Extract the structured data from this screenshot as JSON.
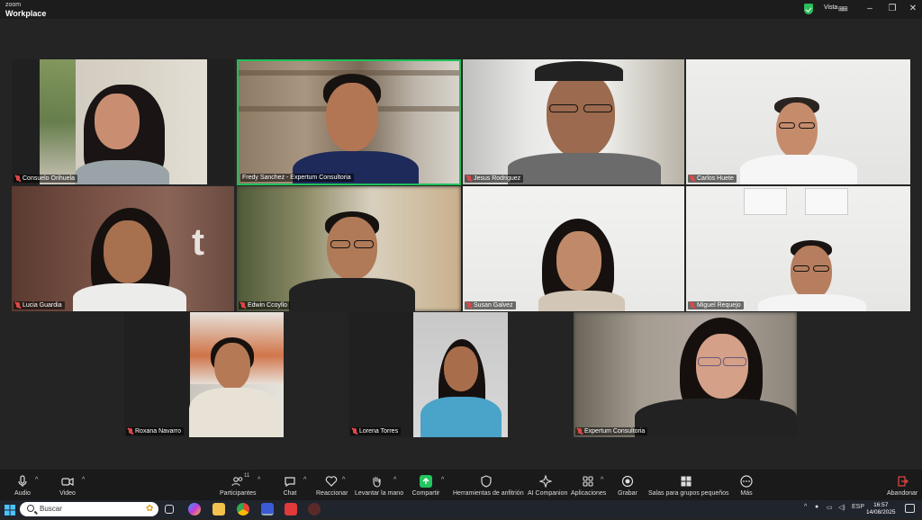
{
  "app": {
    "logo_line1": "zoom",
    "logo_line2": "Workplace",
    "view_label": "Vista",
    "view_icon": "⊞⊞"
  },
  "window_controls": {
    "minimize": "–",
    "maximize": "❐",
    "close": "✕"
  },
  "participants": [
    {
      "name": "Consuelo Orihuela",
      "muted": true
    },
    {
      "name": "Fredy Sanchez - Expertum Consultoria",
      "muted": false,
      "active_speaker": true
    },
    {
      "name": "Jesus Rodriguez",
      "muted": true
    },
    {
      "name": "Carlos Huete",
      "muted": true
    },
    {
      "name": "Lucia Guardia",
      "muted": true
    },
    {
      "name": "Edwin Ccoyllo",
      "muted": true
    },
    {
      "name": "Susan Galvez",
      "muted": true
    },
    {
      "name": "Miguel Requejo",
      "muted": true
    },
    {
      "name": "Roxana Navarro",
      "muted": true
    },
    {
      "name": "Lorena Torres",
      "muted": true
    },
    {
      "name": "Expertum Consultoria",
      "muted": true
    }
  ],
  "toolbar": {
    "audio": "Audio",
    "video": "Video",
    "participants": "Participantes",
    "participants_count": "11",
    "chat": "Chat",
    "reactions": "Reaccionar",
    "raise_hand": "Levantar la mano",
    "share": "Compartir",
    "host_tools": "Herramientas de anfitrión",
    "ai_companion": "AI Companion",
    "apps": "Aplicaciones",
    "record": "Grabar",
    "breakout": "Salas para grupos pequeños",
    "more": "Más",
    "leave": "Abandonar"
  },
  "taskbar": {
    "search_placeholder": "Buscar",
    "language": "ESP",
    "time": "16:57",
    "date": "14/08/2025"
  },
  "colors": {
    "active_border": "#20c05a",
    "share_green": "#23c55e",
    "muted_red": "#e24646"
  }
}
